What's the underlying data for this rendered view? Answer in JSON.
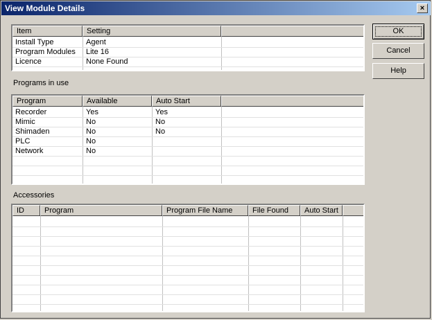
{
  "window": {
    "title": "View Module Details",
    "close_glyph": "×"
  },
  "buttons": {
    "ok": "OK",
    "cancel": "Cancel",
    "help": "Help"
  },
  "modules": {
    "columns": [
      "Item",
      "Setting"
    ],
    "rows": [
      {
        "item": "Install Type",
        "setting": "Agent"
      },
      {
        "item": "Program Modules",
        "setting": "Lite 16"
      },
      {
        "item": "Licence",
        "setting": "None Found"
      }
    ]
  },
  "programs": {
    "label": "Programs in use",
    "columns": [
      "Program",
      "Available",
      "Auto Start"
    ],
    "rows": [
      {
        "program": "Recorder",
        "available": "Yes",
        "auto_start": "Yes"
      },
      {
        "program": "Mimic",
        "available": "No",
        "auto_start": "No"
      },
      {
        "program": "Shimaden",
        "available": "No",
        "auto_start": "No"
      },
      {
        "program": "PLC",
        "available": "No",
        "auto_start": ""
      },
      {
        "program": "Network",
        "available": "No",
        "auto_start": ""
      }
    ]
  },
  "accessories": {
    "label": "Accessories",
    "columns": [
      "ID",
      "Program",
      "Program File Name",
      "File Found",
      "Auto Start"
    ],
    "rows": []
  }
}
